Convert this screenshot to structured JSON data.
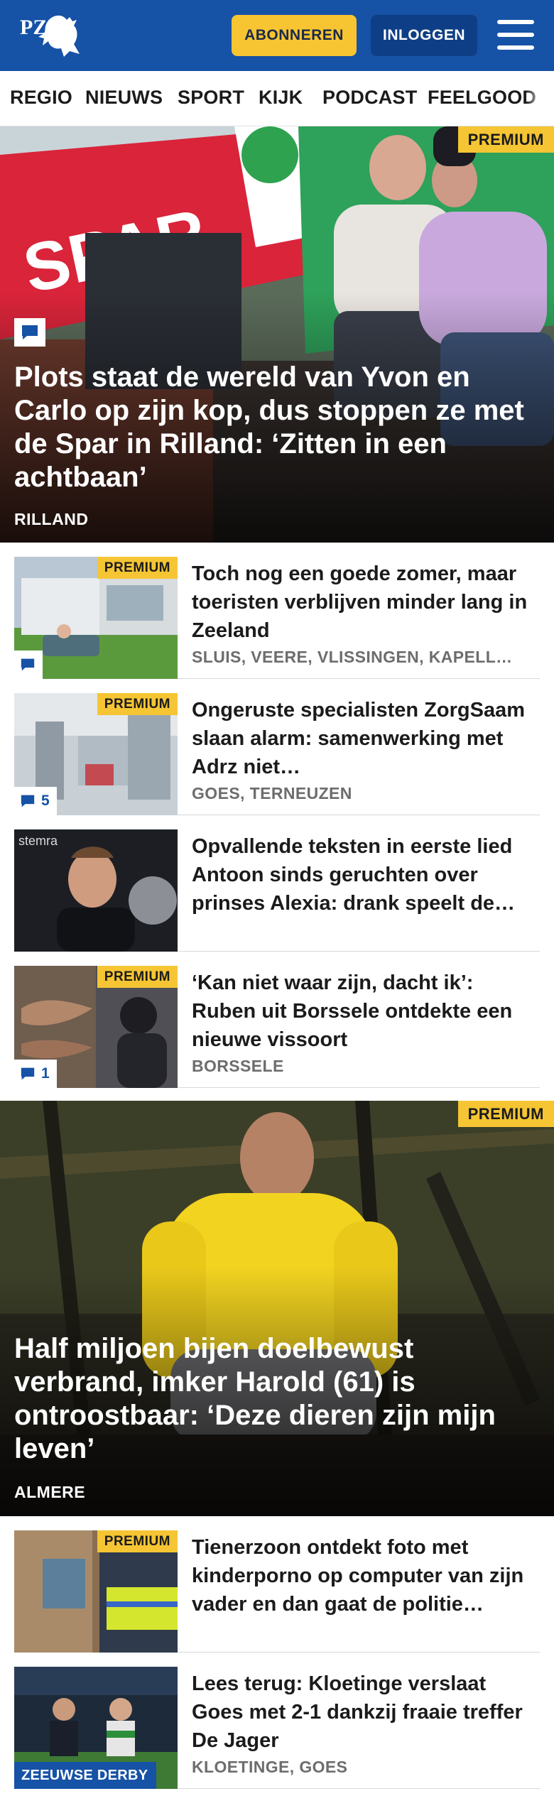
{
  "header": {
    "logo_text": "PZC",
    "subscribe_label": "ABONNEREN",
    "login_label": "INLOGGEN"
  },
  "nav": {
    "items": [
      "REGIO",
      "NIEUWS",
      "SPORT",
      "KIJK",
      "PODCAST",
      "FEELGOOD"
    ]
  },
  "hero1": {
    "badge": "PREMIUM",
    "title": "Plots staat de wereld van Yvon en Carlo op zijn kop, dus stoppen ze met de Spar in Rilland: ‘Zitten in een achtbaan’",
    "location": "RILLAND",
    "sign_text": "SPAR"
  },
  "list1": [
    {
      "badge": "PREMIUM",
      "title": "Toch nog een goede zomer, maar toeristen verblijven minder lang in Zeeland",
      "location": "SLUIS, VEERE, VLISSINGEN, KAPELL…",
      "comments": ""
    },
    {
      "badge": "PREMIUM",
      "title": "Ongeruste specialisten ZorgSaam slaan alarm: samenwerking met Adrz niet…",
      "location": "GOES, TERNEUZEN",
      "comments": "5"
    },
    {
      "badge": "",
      "title": "Opvallende teksten in eerste lied Antoon sinds geruchten over prinses Alexia: drank speelt de…",
      "location": "",
      "comments": "",
      "bg_text": "stemra"
    },
    {
      "badge": "PREMIUM",
      "title": "‘Kan niet waar zijn, dacht ik’: Ruben uit Borssele ontdekte een nieuwe vissoort",
      "location": "BORSSELE",
      "comments": "1"
    }
  ],
  "hero2": {
    "badge": "PREMIUM",
    "title": "Half miljoen bijen doelbewust verbrand, imker Harold (61) is ontroostbaar: ‘Deze dieren zijn mijn leven’",
    "location": "ALMERE"
  },
  "list2": [
    {
      "badge": "PREMIUM",
      "title": "Tienerzoon ontdekt foto met kinderporno op computer van zijn vader en dan gaat de politie…",
      "location": "",
      "comments": ""
    },
    {
      "badge": "",
      "title": "Lees terug: Kloetinge verslaat Goes met 2-1 dankzij fraaie treffer De Jager",
      "location": "KLOETINGE, GOES",
      "comments": "",
      "tag": "ZEEUWSE DERBY"
    }
  ],
  "colors": {
    "brand_blue": "#1652a6",
    "dark_blue": "#0e3f86",
    "premium_yellow": "#f5c533",
    "location_grey": "#6d6d6d"
  }
}
